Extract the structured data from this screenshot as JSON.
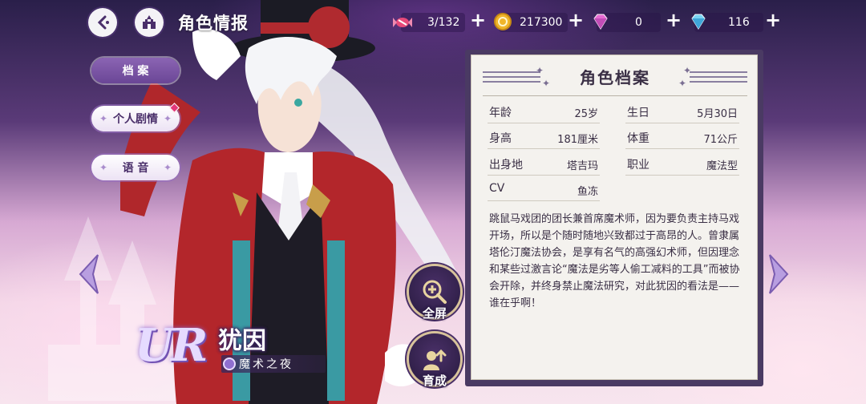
{
  "header": {
    "title": "角色情报"
  },
  "resources": [
    {
      "icon": "candy-icon",
      "value": "3/132"
    },
    {
      "icon": "gold-coin-icon",
      "value": "217300"
    },
    {
      "icon": "pink-gem-icon",
      "value": "0"
    },
    {
      "icon": "blue-diamond-icon",
      "value": "116"
    }
  ],
  "menu": {
    "profile": "档 案",
    "story": "个人剧情",
    "voice": "语 音"
  },
  "character": {
    "rarity": "UR",
    "name": "犹因",
    "title": "魔术之夜"
  },
  "actions": {
    "fullscreen": "全屏",
    "develop": "育成"
  },
  "profile": {
    "heading": "角色档案",
    "fields": [
      {
        "label": "年龄",
        "value": "25岁"
      },
      {
        "label": "生日",
        "value": "5月30日"
      },
      {
        "label": "身高",
        "value": "181厘米"
      },
      {
        "label": "体重",
        "value": "71公斤"
      },
      {
        "label": "出身地",
        "value": "塔吉玛"
      },
      {
        "label": "职业",
        "value": "魔法型"
      },
      {
        "label": "CV",
        "value": "鱼冻"
      }
    ],
    "bio": "跳鼠马戏团的团长兼首席魔术师，因为要负责主持马戏开场，所以是个随时随地兴致都过于高昂的人。曾隶属塔伦汀魔法协会，是享有名气的高强幻术师，但因理念和某些过激言论“魔法是劣等人偷工减料的工具”而被协会开除，并终身禁止魔法研究，对此犹因的看法是——谁在乎啊！"
  },
  "colors": {
    "panel_bg": "#f4f2ee",
    "panel_frame": "#4a3a63",
    "menu_active": "#7a55a6",
    "text_dark": "#3a2f45"
  }
}
